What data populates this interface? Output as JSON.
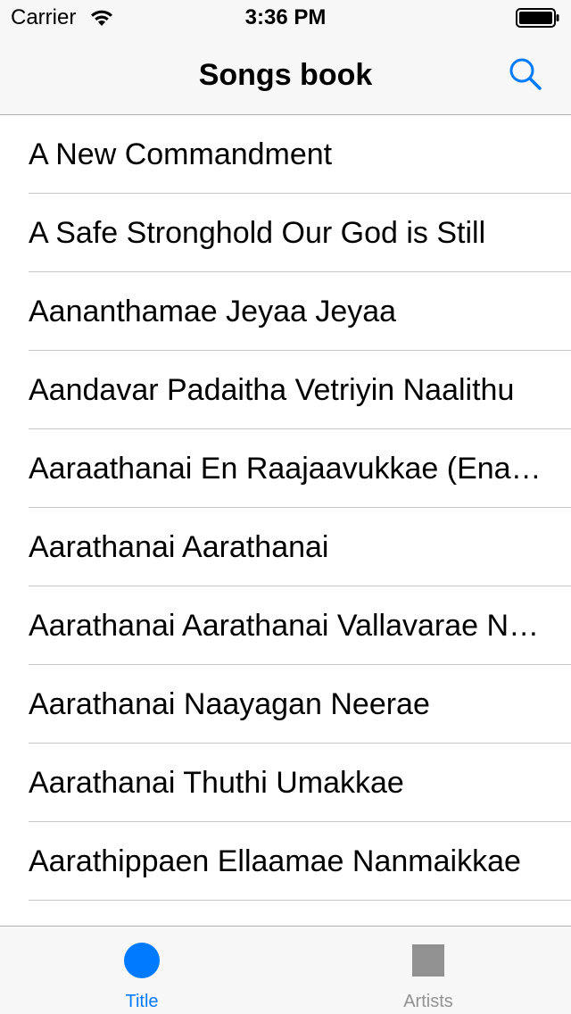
{
  "status_bar": {
    "carrier": "Carrier",
    "time": "3:36 PM"
  },
  "nav": {
    "title": "Songs book",
    "search_icon": "search-icon"
  },
  "songs": [
    "A New Commandment",
    "A Safe Stronghold Our God is Still",
    "Aananthamae Jeyaa Jeyaa",
    "Aandavar Padaitha Vetriyin Naalithu",
    "Aaraathanai En Raajaavukkae (Enakkulae Irukkum Aaviyae)",
    "Aarathanai Aarathanai",
    "Aarathanai Aarathanai Vallavarae Naan",
    "Aarathanai Naayagan Neerae",
    "Aarathanai Thuthi Umakkae",
    "Aarathippaen Ellaamae Nanmaikkae"
  ],
  "tabs": [
    {
      "label": "Title",
      "icon": "circle-icon",
      "active": true
    },
    {
      "label": "Artists",
      "icon": "square-icon",
      "active": false
    }
  ],
  "colors": {
    "accent": "#007aff",
    "inactive": "#929292",
    "bar_background": "#f7f7f7",
    "separator": "#c8c7cc"
  }
}
